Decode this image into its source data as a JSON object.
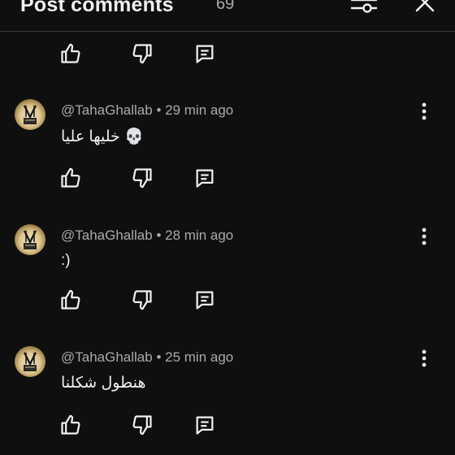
{
  "header": {
    "title": "Post comments",
    "count": "69"
  },
  "comments": [
    {
      "author": "@TahaGhallab",
      "separator": "•",
      "time": "29 min ago",
      "text": "خليها عليا 💀"
    },
    {
      "author": "@TahaGhallab",
      "separator": "•",
      "time": "28 min ago",
      "text": ":)"
    },
    {
      "author": "@TahaGhallab",
      "separator": "•",
      "time": "25 min ago",
      "text": "هنطول شكلنا"
    }
  ],
  "icons": {
    "like": "thumb-up-icon",
    "dislike": "thumb-down-icon",
    "reply": "reply-comment-icon",
    "more": "more-vertical-icon",
    "filter": "filter-sliders-icon",
    "close": "close-icon"
  },
  "colors": {
    "background": "#0f0f0f",
    "text": "#f1f1f1",
    "secondary_text": "#aaaaaa"
  }
}
